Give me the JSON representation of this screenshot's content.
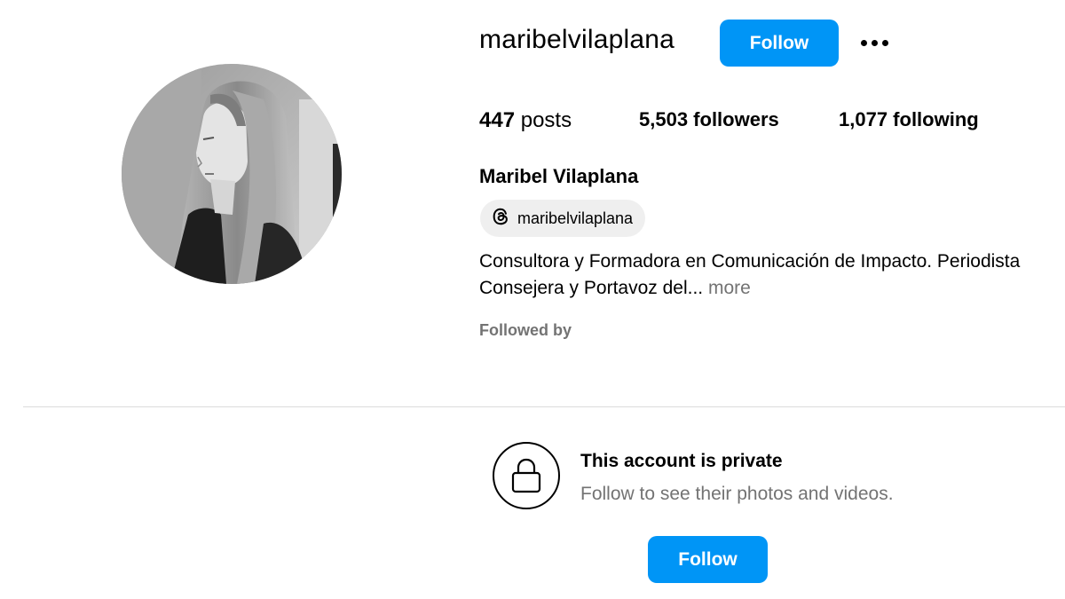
{
  "profile": {
    "username": "maribelvilaplana",
    "full_name": "Maribel Vilaplana",
    "avatar_icon": "profile-photo"
  },
  "header": {
    "follow_label": "Follow",
    "more_icon": "more-options-icon"
  },
  "stats": {
    "posts_count": "447",
    "posts_label": " posts",
    "followers_count": "5,503",
    "followers_label": " followers",
    "following_count": "1,077",
    "following_label": " following"
  },
  "threads": {
    "icon": "threads-icon",
    "handle": "maribelvilaplana"
  },
  "bio": {
    "line1": "Consultora y Formadora en Comunicación de Impacto. Periodista",
    "line2": "Consejera y Portavoz del...",
    "more_label": "more"
  },
  "followed_by": {
    "label": "Followed by"
  },
  "private_notice": {
    "icon": "lock-icon",
    "title": "This account is private",
    "subtitle": "Follow to see their photos and videos.",
    "follow_label": "Follow"
  },
  "colors": {
    "accent": "#0095f6",
    "secondary_text": "#737373",
    "divider": "#dbdbdb",
    "pill_bg": "#efefef"
  }
}
